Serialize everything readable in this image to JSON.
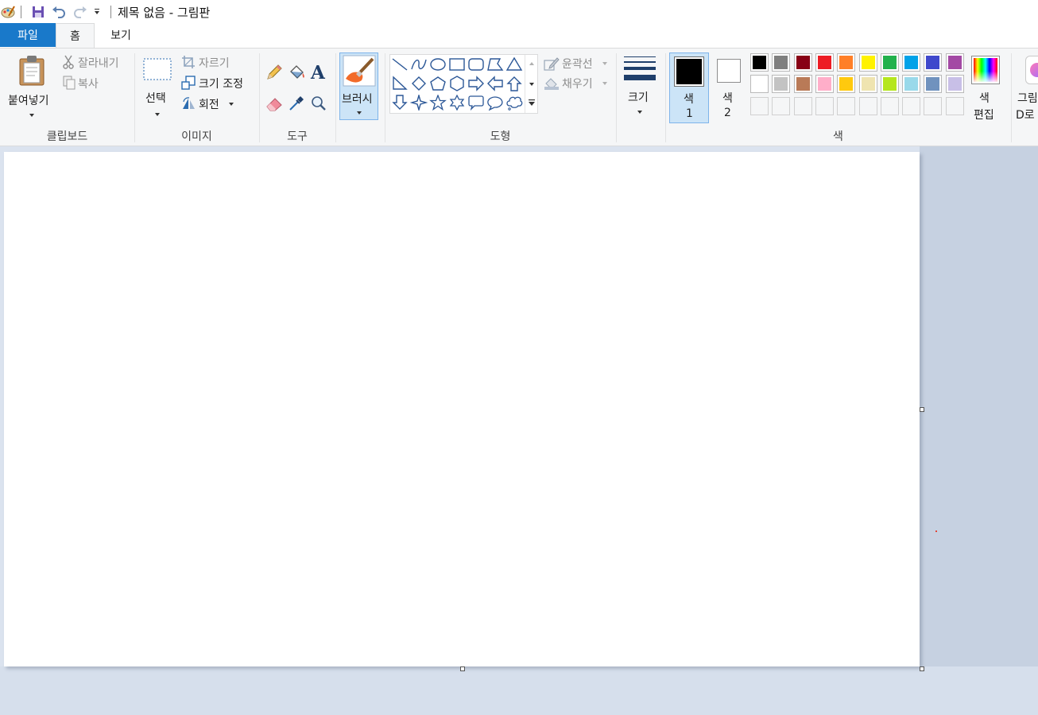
{
  "window": {
    "title": "제목 없음 - 그림판"
  },
  "quick_access": {
    "icons": [
      "paint-app-icon",
      "save-icon",
      "undo-icon",
      "redo-icon",
      "customize-dropdown-icon"
    ]
  },
  "tabs": [
    {
      "label": "파일",
      "active": false
    },
    {
      "label": "홈",
      "active": true
    },
    {
      "label": "보기",
      "active": false
    }
  ],
  "ribbon": {
    "clipboard": {
      "paste_label": "붙여넣기",
      "cut_label": "잘라내기",
      "copy_label": "복사",
      "group_label": "클립보드"
    },
    "image": {
      "select_label": "선택",
      "crop_label": "자르기",
      "resize_label": "크기 조정",
      "rotate_label": "회전",
      "group_label": "이미지"
    },
    "tools": {
      "icons": [
        "pencil-icon",
        "fill-bucket-icon",
        "text-icon",
        "eraser-icon",
        "color-picker-icon",
        "magnifier-icon"
      ],
      "text_glyph": "A",
      "group_label": "도구"
    },
    "brushes": {
      "label": "브러시"
    },
    "shapes": {
      "outline_label": "윤곽선",
      "fill_label": "채우기",
      "group_label": "도형",
      "items": [
        "line",
        "curve",
        "oval",
        "rectangle",
        "rounded-rectangle",
        "polygon",
        "triangle",
        "right-triangle",
        "diamond",
        "pentagon",
        "hexagon",
        "right-arrow",
        "left-arrow",
        "up-arrow",
        "down-arrow",
        "four-point-star",
        "five-point-star",
        "six-point-star",
        "rounded-callout",
        "oval-callout",
        "cloud-callout"
      ]
    },
    "size": {
      "label": "크기"
    },
    "colors": {
      "color1_label_top": "색",
      "color1_label_bottom": "1",
      "color2_label_top": "색",
      "color2_label_bottom": "2",
      "color1_value": "#000000",
      "color2_value": "#ffffff",
      "edit_label_top": "색",
      "edit_label_bottom": "편집",
      "group_label": "색",
      "palette_row1": [
        "#000000",
        "#7f7f7f",
        "#880015",
        "#ed1c24",
        "#ff7f27",
        "#fff200",
        "#22b14c",
        "#00a2e8",
        "#3f48cc",
        "#a349a4"
      ],
      "palette_row2": [
        "#ffffff",
        "#c3c3c3",
        "#b97a57",
        "#ffaec9",
        "#ffc90e",
        "#efe4b0",
        "#b5e61d",
        "#99d9ea",
        "#7092be",
        "#c8bfe7"
      ],
      "palette_row3": [
        "",
        "",
        "",
        "",
        "",
        "",
        "",
        "",
        "",
        ""
      ]
    },
    "paint3d": {
      "label_top": "그림",
      "label_bottom": "D로"
    }
  },
  "colors": {
    "accent": "#1979ca",
    "ribbon_bg": "#f5f6f7",
    "workspace_bg": "#dbe3ef",
    "selected_tool_bg": "#cce4f7",
    "shape_stroke": "#2b5797"
  }
}
